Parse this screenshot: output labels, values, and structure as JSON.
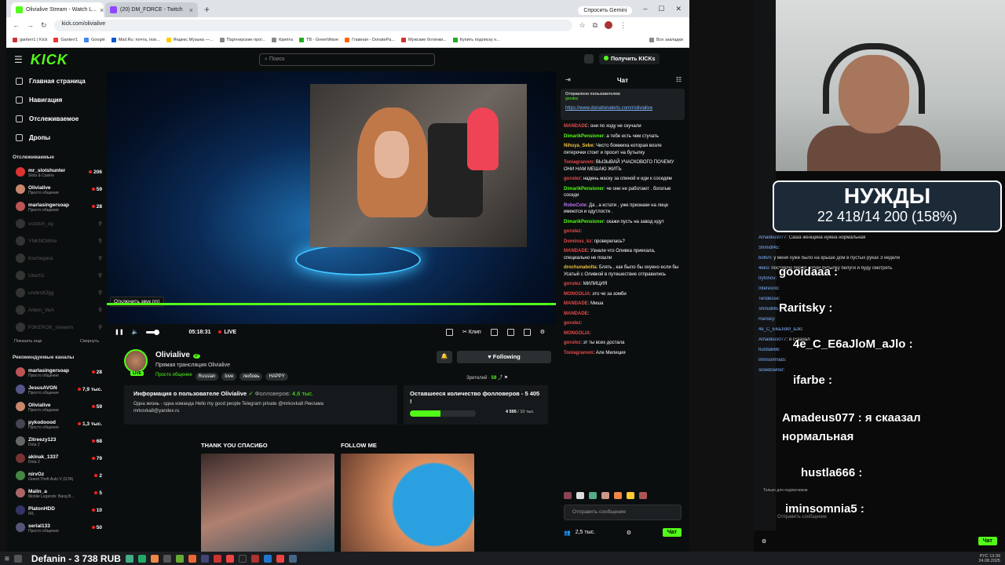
{
  "browser": {
    "tabs": [
      {
        "label": "Olivialive Stream - Watch L...",
        "active": true,
        "color": "#53fc18"
      },
      {
        "label": "(20) DM_FORCE - Twitch",
        "active": false,
        "color": "#9146ff"
      }
    ],
    "gemini_label": "Спросить Gemini",
    "url": "kick.com/olivialive",
    "bookmarks": [
      "ganterr1 | Kick",
      "Ganterr1",
      "Google",
      "Mail.Ru: почта, пои...",
      "Яндекс Музыка —...",
      "Партнерские прог...",
      "Крипта",
      "ТВ - GreenWave",
      "Главная - DonatePa...",
      "Мужские ботинки...",
      "Купить подписку н..."
    ],
    "all_bookmarks": "Все закладки"
  },
  "kick": {
    "logo": "KICK",
    "search_placeholder": "Поиск",
    "get_kicks": "Получить KICKs"
  },
  "sidebar": {
    "nav": [
      "Главная страница",
      "Навигация",
      "Отслеживаемое",
      "Дропы"
    ],
    "followed_title": "Отслеживаемые",
    "followed": [
      {
        "name": "mr_slotshunter",
        "sub": "Slots & Casino",
        "count": "206",
        "online": true,
        "color": "#d33"
      },
      {
        "name": "Olivialive",
        "sub": "Просто общение",
        "count": "59",
        "online": true,
        "color": "#c8866a"
      },
      {
        "name": "marlasingersoap",
        "sub": "Просто общение",
        "count": "28",
        "online": true,
        "color": "#b55"
      },
      {
        "name": "vozduh_og",
        "sub": "",
        "count": "",
        "online": false,
        "color": "#333"
      },
      {
        "name": "YNKNOWne",
        "sub": "",
        "count": "",
        "online": false,
        "color": "#333"
      },
      {
        "name": "Kochegara",
        "sub": "",
        "count": "",
        "online": false,
        "color": "#333"
      },
      {
        "name": "Utech1",
        "sub": "",
        "count": "",
        "online": false,
        "color": "#333"
      },
      {
        "name": "underdOgg",
        "sub": "",
        "count": "",
        "online": false,
        "color": "#333"
      },
      {
        "name": "Artem_VeA",
        "sub": "",
        "count": "",
        "online": false,
        "color": "#333"
      },
      {
        "name": "P3KEROK_streams",
        "sub": "",
        "count": "",
        "online": false,
        "color": "#333"
      }
    ],
    "show_more": "Показать еще",
    "collapse": "Свернуть",
    "recommended_title": "Рекомендуемые каналы",
    "recommended": [
      {
        "name": "marlasingersoap",
        "sub": "Просто общение",
        "count": "28",
        "color": "#b55"
      },
      {
        "name": "JesusAVGN",
        "sub": "Просто общение",
        "count": "7,9 тыс.",
        "color": "#558"
      },
      {
        "name": "Olivialive",
        "sub": "Просто общение",
        "count": "59",
        "color": "#c8866a"
      },
      {
        "name": "pykodoood",
        "sub": "Просто общение",
        "count": "1,3 тыс.",
        "color": "#445"
      },
      {
        "name": "Zitreezy123",
        "sub": "Dota 2",
        "count": "68",
        "color": "#666"
      },
      {
        "name": "akinak_1337",
        "sub": "Dota 2",
        "count": "79",
        "color": "#733"
      },
      {
        "name": "nirvOz",
        "sub": "Grand Theft Auto V (GTA)",
        "count": "2",
        "color": "#484"
      },
      {
        "name": "Malin_a",
        "sub": "Mobile Legends: Bang B...",
        "count": "5",
        "color": "#a66"
      },
      {
        "name": "PlatonHDD",
        "sub": "IRL",
        "count": "10",
        "color": "#336"
      },
      {
        "name": "serial133",
        "sub": "Просто общение",
        "count": "50",
        "color": "#557"
      }
    ]
  },
  "player": {
    "tooltip": "Отключить звук (m)",
    "time": "05:18:31",
    "live": "LIVE",
    "clip": "Клип"
  },
  "streamer": {
    "name": "Olivialive",
    "title": "Прямая трансляция Olivialive",
    "live_badge": "LIVE",
    "category": "Просто общение",
    "tags": [
      "Russian",
      "love",
      "любовь",
      "HAPPY"
    ],
    "follow_label": "Following",
    "viewers_label": "Зрителей",
    "viewers": "59"
  },
  "about": {
    "title": "Информация о пользователе Olivialive",
    "followers_label": "Фолловеров:",
    "followers": "4,6 тыс.",
    "text1": "Одна жизнь - одна команда Hello my good people   Telegram private @mrkovka8 Реклама",
    "text2": "mrkovka8@yandex.ru"
  },
  "goal": {
    "title": "Оставшееся количество фолловеров - 5 405 !",
    "current": "4 595",
    "target": "/ 10 тыс.",
    "progress": 0.46
  },
  "panels": [
    "THANK YOU СПАСИБО",
    "FOLLOW ME"
  ],
  "chat": {
    "title": "Чат",
    "pinned_by": "Отправлено пользователем",
    "pinned_user": "gorulez",
    "pinned_link": "https://www.donationalerts.com/r/olivialive",
    "messages": [
      {
        "user": "MANDADE",
        "text": "они по ходу не скучали",
        "color": "#e84a4a"
      },
      {
        "user": "DimarikPensioner",
        "text": "а тебе есть чем стучать",
        "color": "#53fc18"
      },
      {
        "user": "Nihuya_Sebe",
        "text": "Чисто бомжиха которая возле пятерочки стоит и просит на бутылку",
        "color": "#f0c040"
      },
      {
        "user": "Toniagranom",
        "text": "ВЫЗЫВАЙ УЧАСКОВОГО ПОЧЕМУ ОНИ НАМ МЕШАЮ ЖИТЬ",
        "color": "#e84a4a"
      },
      {
        "user": "gorulez",
        "text": "надень маску за спиной и иди к соседям",
        "color": "#e84a4a"
      },
      {
        "user": "DimarikPensioner",
        "text": "че они не работают . богатые соседи",
        "color": "#53fc18"
      },
      {
        "user": "RoboCote",
        "text": "Да , а кстати , уже признаки на лице имеются и одутлости .",
        "color": "#c070ff"
      },
      {
        "user": "DimarikPensioner",
        "text": "скажи пусть на завод идут",
        "color": "#53fc18"
      },
      {
        "user": "gorulez",
        "text": "",
        "color": "#e84a4a"
      },
      {
        "user": "Dominus_kz",
        "text": "проверелась?",
        "color": "#e84a4a"
      },
      {
        "user": "MANDADE",
        "text": "Узнали что Оливка приехала, специально не пошли",
        "color": "#e84a4a"
      },
      {
        "user": "drochunabolta",
        "text": "Блять , как было бы охуено если бы Усатый с Оливкой в путешествие отправились",
        "color": "#f0c040"
      },
      {
        "user": "gorulez",
        "text": "МИЛИЦИЯ",
        "color": "#e84a4a"
      },
      {
        "user": "MONGOLIA",
        "text": "это че за зомби",
        "color": "#e84a4a"
      },
      {
        "user": "MANDADE",
        "text": "Миша",
        "color": "#e84a4a"
      },
      {
        "user": "MANDADE",
        "text": "",
        "color": "#e84a4a"
      },
      {
        "user": "gorulez",
        "text": "",
        "color": "#e84a4a"
      },
      {
        "user": "MONGOLIA",
        "text": "",
        "color": "#e84a4a"
      },
      {
        "user": "gorulez",
        "text": "эт ты всех достала",
        "color": "#e84a4a"
      },
      {
        "user": "Toniagranom",
        "text": "Але Милиция",
        "color": "#e84a4a"
      }
    ],
    "input_placeholder": "Отправить сообщение",
    "viewers": "2,5 тыс.",
    "send": "Чат"
  },
  "overlay": {
    "goal_title": "НУЖДЫ",
    "goal_value": "22 418/14 200 (158%)",
    "lines": [
      {
        "user": "Amadeus077",
        "text": "Саша женщина нужна нормальная"
      },
      {
        "user": "Shmidt45",
        "text": ""
      },
      {
        "user": "boltvn",
        "text": "у меня хуже было на крыше дом в пустых руках 3 недели"
      },
      {
        "user": "4eko",
        "text": "поставлю перед собой бутылку белуги и буду смотреть"
      },
      {
        "user": "tryfonov",
        "text": ""
      },
      {
        "user": "Interesno",
        "text": ""
      },
      {
        "user": "Tendesse",
        "text": ""
      },
      {
        "user": "Shmidt45",
        "text": ""
      },
      {
        "user": "Rarisky",
        "text": ""
      },
      {
        "user": "4e_C_E6aJloM_aJlo",
        "text": ""
      },
      {
        "user": "Amadeus077",
        "text": "я скаазал"
      },
      {
        "user": "hustla666",
        "text": ""
      },
      {
        "user": "iminsomnia5",
        "text": ""
      },
      {
        "user": "slowdowner",
        "text": ""
      }
    ],
    "big_lines": [
      {
        "user": "gooidaaa",
        "text": ""
      },
      {
        "user": "Raritsky",
        "text": ""
      },
      {
        "user": "4e_C_E6aJloM_aJlo",
        "text": ""
      },
      {
        "user": "ifarbe",
        "text": ""
      },
      {
        "user": "Amadeus077",
        "text": "я скаазал"
      },
      {
        "user": "",
        "text": "нормальная"
      },
      {
        "user": "hustla666",
        "text": ""
      },
      {
        "user": "iminsomnia5",
        "text": ""
      }
    ],
    "subs_only": "Только для подписчиков",
    "input_placeholder": "Отправить сообщение",
    "send": "Чат"
  },
  "taskbar": {
    "donation": "Defanin - 3 738 RUB",
    "lang": "РУС",
    "time": "13:39",
    "date": "24.08.2025"
  }
}
